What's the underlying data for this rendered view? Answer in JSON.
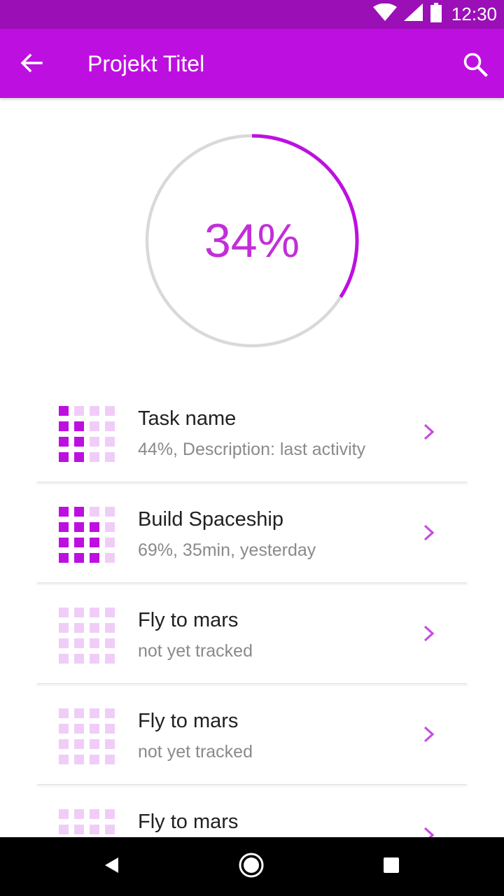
{
  "status_bar": {
    "time": "12:30"
  },
  "app_bar": {
    "title": "Projekt Titel"
  },
  "progress": {
    "percent_label": "34%",
    "value": 0.34
  },
  "colors": {
    "accent": "#bd10e0",
    "status_bar": "#9b0fb6",
    "progress_text": "#c12fd8",
    "cell_full": "#bd10e0",
    "cell_light": "#f0cdf7",
    "chevron": "#c64be2"
  },
  "tasks": [
    {
      "name": "Task name",
      "desc": "44%, Description: last activity",
      "filled_cells": [
        0,
        4,
        5,
        8,
        9,
        12,
        13
      ]
    },
    {
      "name": "Build Spaceship",
      "desc": "69%, 35min, yesterday",
      "filled_cells": [
        0,
        1,
        4,
        5,
        6,
        8,
        9,
        10,
        12,
        13,
        14
      ]
    },
    {
      "name": "Fly to mars",
      "desc": "not yet tracked",
      "filled_cells": []
    },
    {
      "name": "Fly to mars",
      "desc": "not yet tracked",
      "filled_cells": []
    },
    {
      "name": "Fly to mars",
      "desc": "",
      "filled_cells": []
    }
  ],
  "icons": {
    "back": "arrow-left-icon",
    "search": "search-icon",
    "chevron": "chevron-right-icon",
    "wifi": "wifi-icon",
    "signal": "signal-icon",
    "battery": "battery-icon",
    "nav_back": "nav-back-icon",
    "nav_home": "nav-home-icon",
    "nav_recents": "nav-recents-icon"
  }
}
